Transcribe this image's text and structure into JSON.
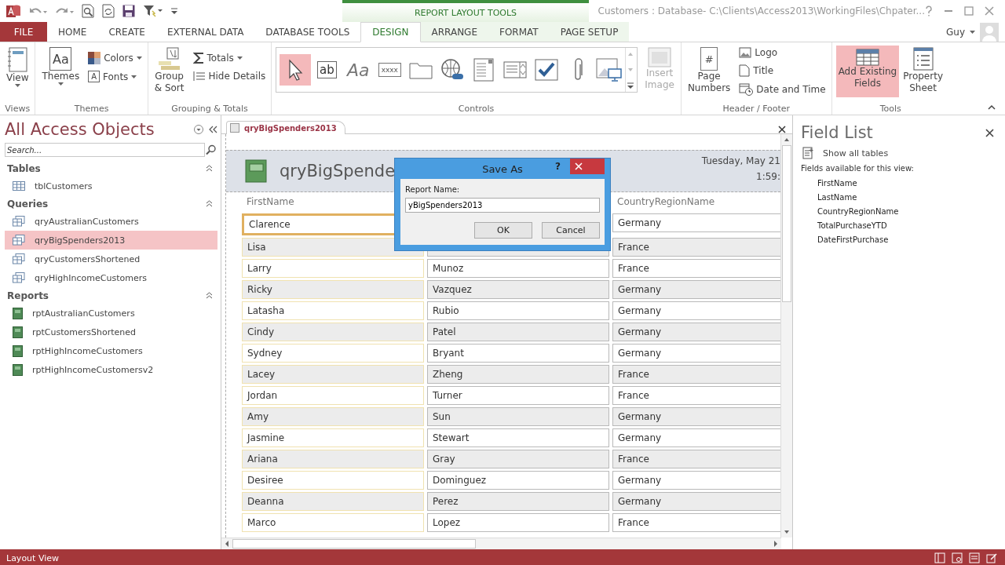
{
  "window": {
    "title": "Customers : Database- C:\\Clients\\Access2013\\WorkingFiles\\Chpater...",
    "context_group": "REPORT LAYOUT TOOLS",
    "user": "Guy"
  },
  "ribbon_tabs": [
    {
      "label": "FILE",
      "kind": "file",
      "selected": false
    },
    {
      "label": "HOME",
      "kind": "tab",
      "selected": false
    },
    {
      "label": "CREATE",
      "kind": "tab",
      "selected": false
    },
    {
      "label": "EXTERNAL DATA",
      "kind": "tab",
      "selected": false
    },
    {
      "label": "DATABASE TOOLS",
      "kind": "tab",
      "selected": false
    },
    {
      "label": "DESIGN",
      "kind": "context",
      "selected": true
    },
    {
      "label": "ARRANGE",
      "kind": "context",
      "selected": false
    },
    {
      "label": "FORMAT",
      "kind": "context",
      "selected": false
    },
    {
      "label": "PAGE SETUP",
      "kind": "context",
      "selected": false
    }
  ],
  "ribbon": {
    "view": "View",
    "themes": "Themes",
    "themes_glyph": "Aa",
    "colors": "Colors",
    "fonts": "Fonts",
    "fonts_glyph": "A",
    "group_sort": "Group\n& Sort",
    "totals": "Totals",
    "hide_details": "Hide Details",
    "controls": [
      {
        "kind": "pointer",
        "selected": true
      },
      {
        "kind": "textbox",
        "glyph": "ab",
        "selected": false
      },
      {
        "kind": "label",
        "glyph": "Aa",
        "selected": false
      },
      {
        "kind": "button",
        "glyph": "xxxx",
        "selected": false
      },
      {
        "kind": "tab",
        "selected": false
      },
      {
        "kind": "hyperlink",
        "selected": false
      },
      {
        "kind": "listbox",
        "selected": false
      },
      {
        "kind": "combo",
        "selected": false
      },
      {
        "kind": "checkbox",
        "selected": false
      },
      {
        "kind": "attachment",
        "selected": false
      },
      {
        "kind": "image",
        "selected": false
      }
    ],
    "insert_image": {
      "label": "Insert\nImage",
      "disabled": true
    },
    "page_numbers": "Page\nNumbers",
    "page_glyph": "#",
    "logo": "Logo",
    "title": "Title",
    "date_time": "Date and Time",
    "tools": [
      {
        "label": "Add Existing\nFields",
        "kind": "fields",
        "selected": true
      },
      {
        "label": "Property\nSheet",
        "kind": "sheet",
        "selected": false
      }
    ],
    "group_labels": [
      "Views",
      "Themes",
      "Grouping & Totals",
      "Controls",
      "Header / Footer",
      "Tools"
    ]
  },
  "nav": {
    "title": "All Access Objects",
    "search_placeholder": "Search...",
    "groups": [
      {
        "name": "Tables",
        "kind": "table",
        "items": [
          {
            "label": "tblCustomers",
            "selected": false
          }
        ]
      },
      {
        "name": "Queries",
        "kind": "query",
        "items": [
          {
            "label": "qryAustralianCustomers",
            "selected": false
          },
          {
            "label": "qryBigSpenders2013",
            "selected": true
          },
          {
            "label": "qryCustomersShortened",
            "selected": false
          },
          {
            "label": "qryHighIncomeCustomers",
            "selected": false
          }
        ]
      },
      {
        "name": "Reports",
        "kind": "report",
        "items": [
          {
            "label": "rptAustralianCustomers",
            "selected": false
          },
          {
            "label": "rptCustomersShortened",
            "selected": false
          },
          {
            "label": "rptHighIncomeCustomers",
            "selected": false
          },
          {
            "label": "rptHighIncomeCustomersv2",
            "selected": false
          }
        ]
      }
    ]
  },
  "document": {
    "tab": "qryBigSpenders2013",
    "report_title": "qryBigSpende",
    "date": "Tuesday, May 21",
    "time": "1:59:",
    "column_headers": [
      "FirstName",
      "CountryRegionName"
    ],
    "rows": [
      {
        "first": "Clarence",
        "country": "Germany"
      },
      {
        "first": "Lisa",
        "country": "France"
      },
      {
        "first": "Larry",
        "last": "Munoz",
        "country": "France"
      },
      {
        "first": "Ricky",
        "last": "Vazquez",
        "country": "Germany"
      },
      {
        "first": "Latasha",
        "last": "Rubio",
        "country": "Germany"
      },
      {
        "first": "Cindy",
        "last": "Patel",
        "country": "Germany"
      },
      {
        "first": "Sydney",
        "last": "Bryant",
        "country": "Germany"
      },
      {
        "first": "Lacey",
        "last": "Zheng",
        "country": "France"
      },
      {
        "first": "Jordan",
        "last": "Turner",
        "country": "France"
      },
      {
        "first": "Amy",
        "last": "Sun",
        "country": "Germany"
      },
      {
        "first": "Jasmine",
        "last": "Stewart",
        "country": "Germany"
      },
      {
        "first": "Ariana",
        "last": "Gray",
        "country": "France"
      },
      {
        "first": "Desiree",
        "last": "Dominguez",
        "country": "Germany"
      },
      {
        "first": "Deanna",
        "last": "Perez",
        "country": "Germany"
      },
      {
        "first": "Marco",
        "last": "Lopez",
        "country": "France"
      }
    ]
  },
  "dialog": {
    "title": "Save As",
    "help": "?",
    "label": "Report Name:",
    "value": "yBigSpenders2013",
    "ok": "OK",
    "cancel": "Cancel"
  },
  "field_list": {
    "title": "Field List",
    "show_all": "Show all tables",
    "caption": "Fields available for this view:",
    "fields": [
      "FirstName",
      "LastName",
      "CountryRegionName",
      "TotalPurchaseYTD",
      "DateFirstPurchase"
    ]
  },
  "status_bar": {
    "text": "Layout View"
  }
}
